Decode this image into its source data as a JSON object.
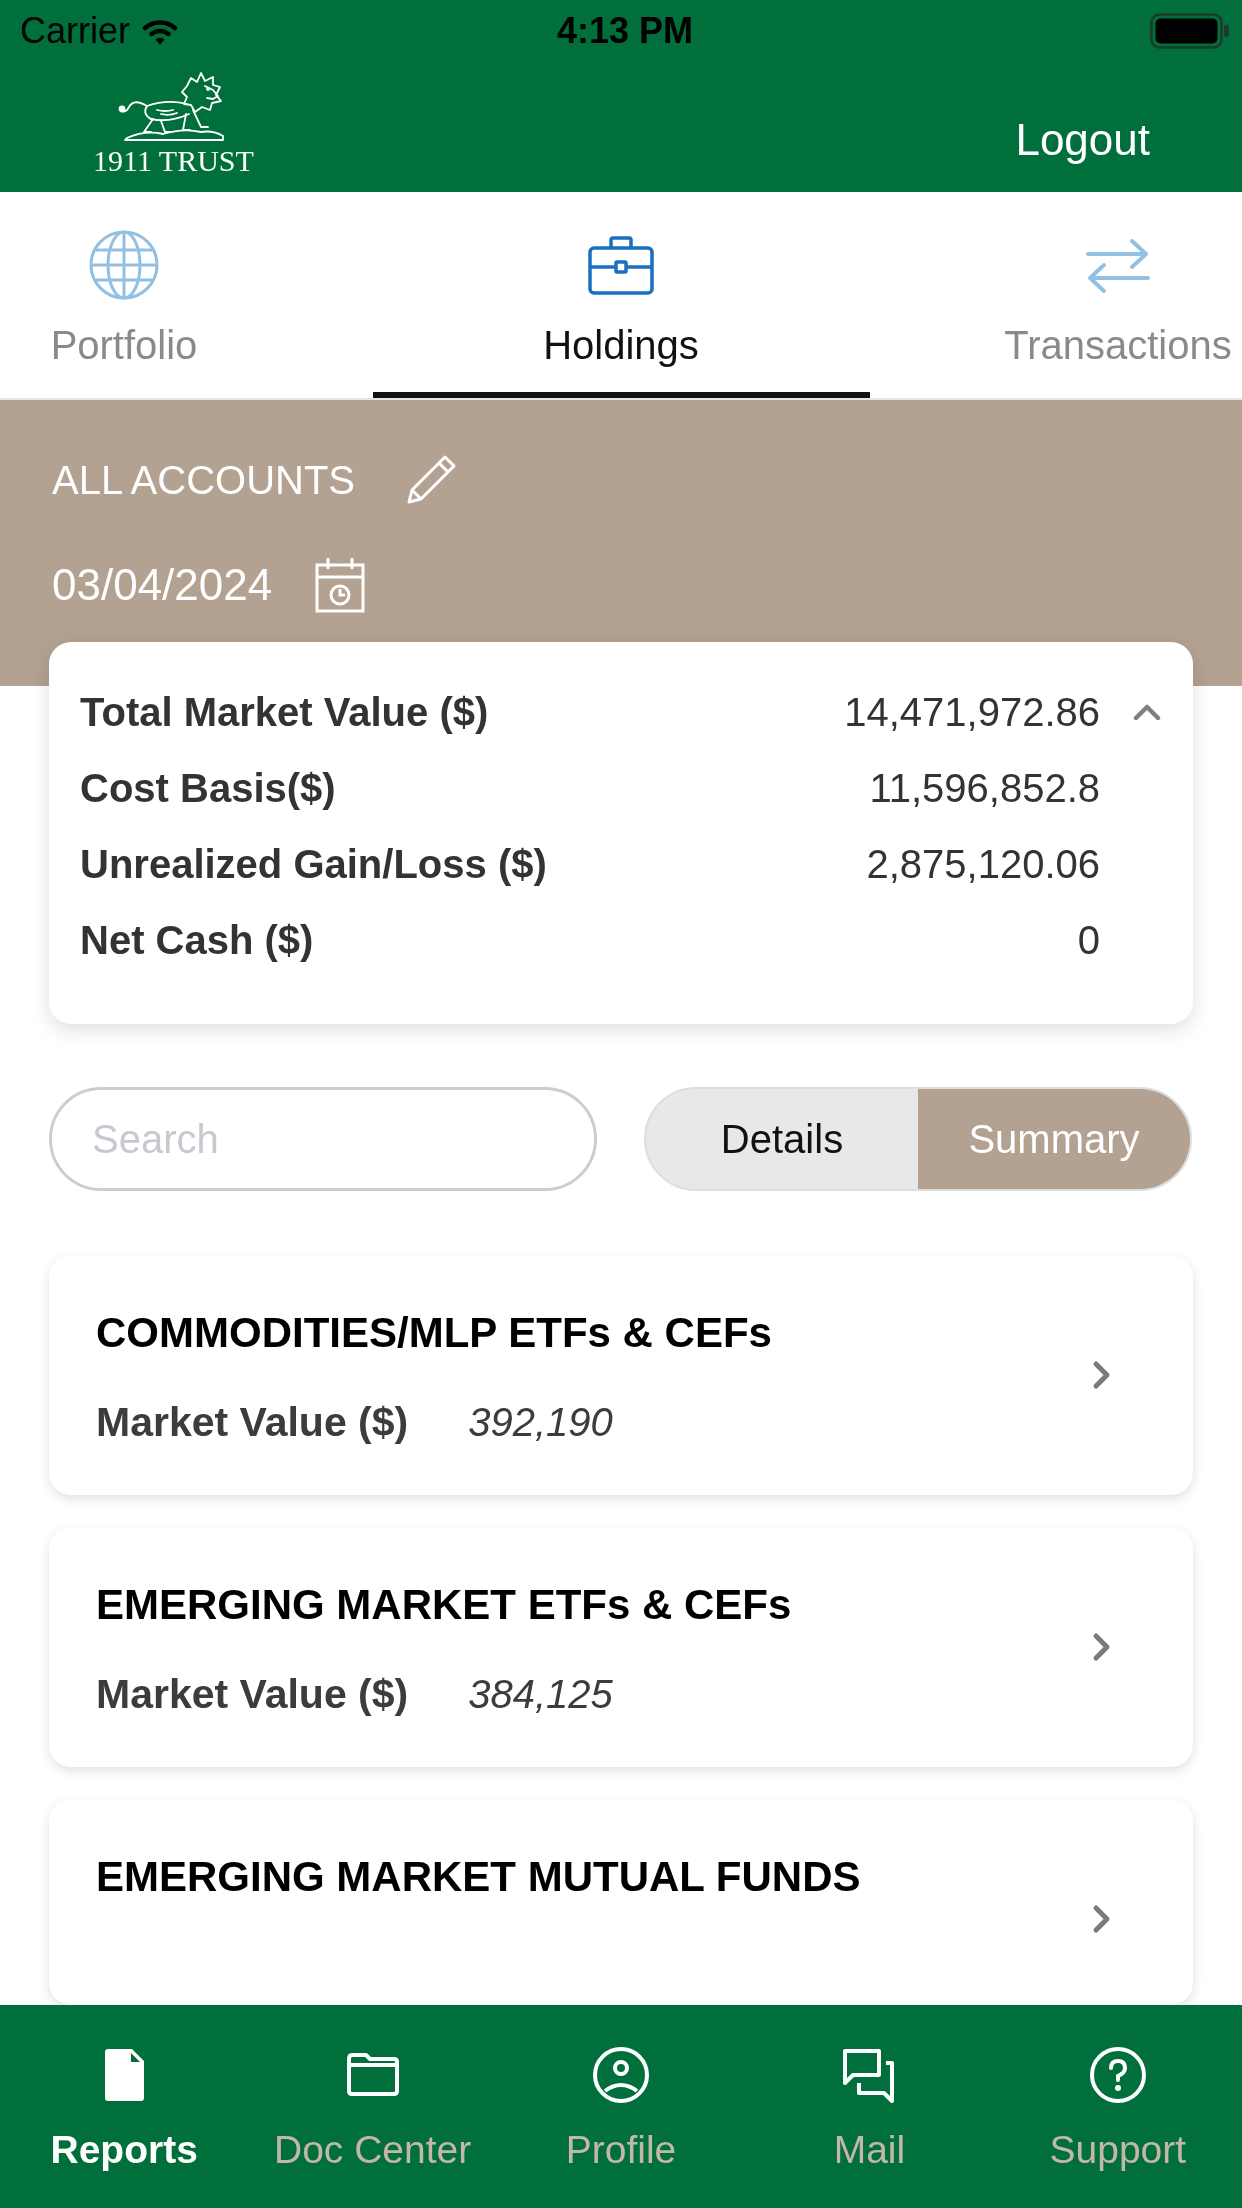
{
  "status_bar": {
    "carrier": "Carrier",
    "time": "4:13 PM"
  },
  "header": {
    "logo_text": "1911 TRUST",
    "logout": "Logout"
  },
  "tabs": [
    {
      "label": "Portfolio",
      "selected": false
    },
    {
      "label": "Holdings",
      "selected": true
    },
    {
      "label": "Transactions",
      "selected": false
    }
  ],
  "account": {
    "name": "ALL ACCOUNTS",
    "date": "03/04/2024"
  },
  "summary": {
    "expanded": true,
    "rows": [
      {
        "label": "Total Market Value ($)",
        "value": "14,471,972.86"
      },
      {
        "label": "Cost Basis($)",
        "value": "11,596,852.8"
      },
      {
        "label": "Unrealized Gain/Loss ($)",
        "value": "2,875,120.06"
      },
      {
        "label": "Net Cash ($)",
        "value": "0"
      }
    ]
  },
  "search": {
    "placeholder": "Search"
  },
  "view_toggle": [
    {
      "label": "Details",
      "selected": false
    },
    {
      "label": "Summary",
      "selected": true
    }
  ],
  "groups": [
    {
      "title": "COMMODITIES/MLP ETFs & CEFs",
      "value_label": "Market Value ($)",
      "value": "392,190"
    },
    {
      "title": "EMERGING MARKET ETFs & CEFs",
      "value_label": "Market Value ($)",
      "value": "384,125"
    },
    {
      "title": "EMERGING MARKET MUTUAL FUNDS"
    }
  ],
  "bottom_nav": [
    {
      "label": "Reports",
      "selected": true
    },
    {
      "label": "Doc Center",
      "selected": false
    },
    {
      "label": "Profile",
      "selected": false
    },
    {
      "label": "Mail",
      "selected": false
    },
    {
      "label": "Support",
      "selected": false
    }
  ]
}
